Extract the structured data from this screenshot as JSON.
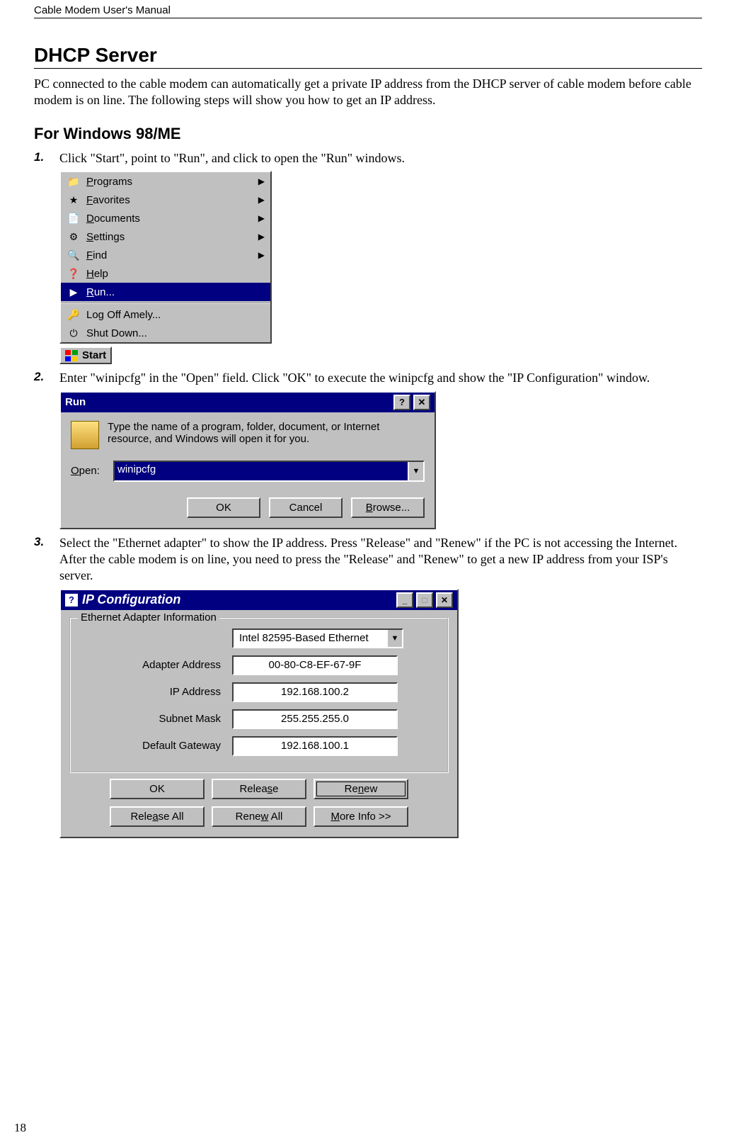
{
  "header": {
    "doc_title": "Cable Modem User's Manual"
  },
  "page_number": "18",
  "section": {
    "title": "DHCP Server",
    "intro": "PC connected to the cable modem can automatically get a private IP address from the DHCP server of cable modem before cable modem is on line. The following steps will show you how to get an IP address.",
    "subheading": "For Windows 98/ME"
  },
  "steps": [
    {
      "num": "1.",
      "text": "Click \"Start\", point to \"Run\", and click to open the \"Run\" windows."
    },
    {
      "num": "2.",
      "text": "Enter \"winipcfg\" in the \"Open\" field. Click \"OK\" to execute the winipcfg and show the \"IP Configuration\" window."
    },
    {
      "num": "3.",
      "text": "Select the \"Ethernet adapter\" to show the IP address. Press \"Release\" and \"Renew\" if the PC is not accessing the Internet. After the cable modem is on line, you need to press the \"Release\" and \"Renew\" to get a new IP address from your ISP's server."
    }
  ],
  "start_menu": {
    "items": [
      {
        "label": "Programs",
        "icon": "📁",
        "arrow": true
      },
      {
        "label": "Favorites",
        "icon": "★",
        "arrow": true
      },
      {
        "label": "Documents",
        "icon": "📄",
        "arrow": true
      },
      {
        "label": "Settings",
        "icon": "⚙",
        "arrow": true
      },
      {
        "label": "Find",
        "icon": "🔍",
        "arrow": true
      },
      {
        "label": "Help",
        "icon": "❓",
        "arrow": false
      },
      {
        "label": "Run...",
        "icon": "▶",
        "arrow": false,
        "selected": true
      }
    ],
    "footer": [
      {
        "label": "Log Off Amely...",
        "icon": "🔑"
      },
      {
        "label": "Shut Down...",
        "icon": "⏻"
      }
    ],
    "start_btn": "Start"
  },
  "run_dialog": {
    "title": "Run",
    "help_text": "Type the name of a program, folder, document, or Internet resource, and Windows will open it for you.",
    "open_label": "Open:",
    "open_value": "winipcfg",
    "buttons": {
      "ok": "OK",
      "cancel": "Cancel",
      "browse": "Browse..."
    }
  },
  "ipcfg_dialog": {
    "title": "IP Configuration",
    "group": "Ethernet Adapter Information",
    "adapter_selected": "Intel 82595-Based Ethernet",
    "rows": {
      "adapter_address_label": "Adapter Address",
      "adapter_address_value": "00-80-C8-EF-67-9F",
      "ip_address_label": "IP Address",
      "ip_address_value": "192.168.100.2",
      "subnet_label": "Subnet Mask",
      "subnet_value": "255.255.255.0",
      "gateway_label": "Default Gateway",
      "gateway_value": "192.168.100.1"
    },
    "buttons": {
      "ok": "OK",
      "release": "Release",
      "renew": "Renew",
      "release_all": "Release All",
      "renew_all": "Renew All",
      "more": "More Info >>"
    }
  }
}
